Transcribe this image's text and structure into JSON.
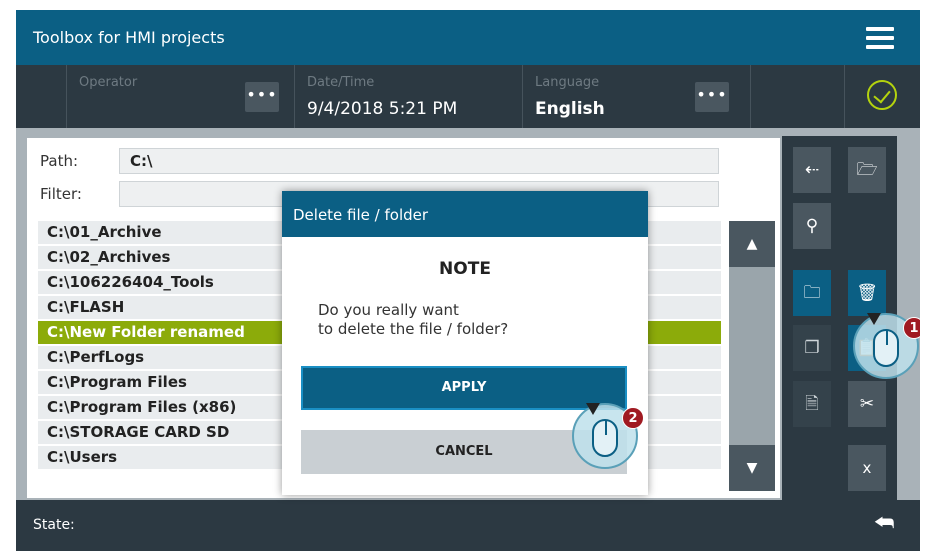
{
  "app": {
    "title": "Toolbox for HMI projects"
  },
  "header": {
    "operator_label": "Operator",
    "datetime_label": "Date/Time",
    "datetime_value": "9/4/2018 5:21 PM",
    "language_label": "Language",
    "language_value": "English",
    "dots": "•••"
  },
  "path": {
    "label": "Path:",
    "value": "C:\\"
  },
  "filter": {
    "label": "Filter:",
    "value": ""
  },
  "files": [
    "C:\\01_Archive",
    "C:\\02_Archives",
    "C:\\106226404_Tools",
    "C:\\FLASH",
    "C:\\New Folder renamed",
    "C:\\PerfLogs",
    "C:\\Program Files",
    "C:\\Program Files (x86)",
    "C:\\STORAGE CARD SD",
    "C:\\Users"
  ],
  "selected_index": 4,
  "toolbar": {
    "close_label": "x"
  },
  "status": {
    "label": "State:"
  },
  "dialog": {
    "title": "Delete file / folder",
    "heading": "NOTE",
    "message_line1": "Do you really want",
    "message_line2": "to delete the file / folder?",
    "apply_label": "APPLY",
    "cancel_label": "CANCEL"
  },
  "callouts": [
    {
      "number": "1"
    },
    {
      "number": "2"
    }
  ],
  "colors": {
    "brand": "#0b5f84",
    "selected": "#8cab0a",
    "ok": "#b4d30e",
    "badge": "#a01a22"
  },
  "icons": [
    "menu-icon",
    "check-circle-icon",
    "back-arrow-icon",
    "folder-download-icon",
    "search-icon",
    "new-folder-icon",
    "trash-icon",
    "copy-icon",
    "paste-icon",
    "cut-icon",
    "close-icon",
    "chevron-up-icon",
    "chevron-down-icon",
    "return-icon",
    "mouse-click-icon"
  ]
}
